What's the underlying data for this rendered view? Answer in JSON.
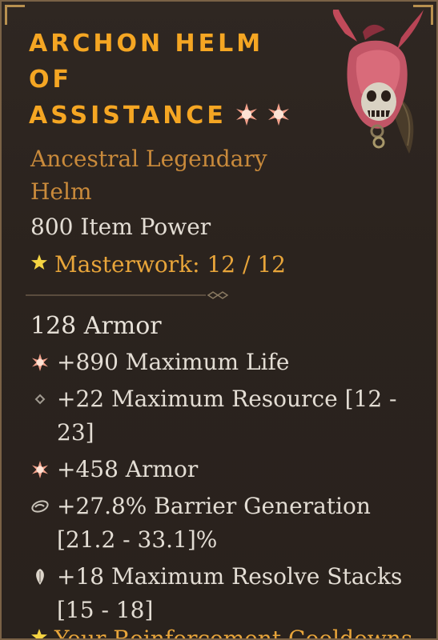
{
  "item": {
    "name_line1": "ARCHON HELM",
    "name_line2": "OF",
    "name_line3": "ASSISTANCE",
    "rarity_line1": "Ancestral Legendary",
    "rarity_line2": "Helm",
    "item_power": "800 Item Power",
    "masterwork": "Masterwork: 12 / 12",
    "base_armor": "128 Armor"
  },
  "affixes": [
    {
      "text": "+890 Maximum Life",
      "icon": "greater-affix-star-icon"
    },
    {
      "text": "+22 Maximum Resource [12 - 23]",
      "icon": "diamond-bullet-icon"
    },
    {
      "text": "+458 Armor",
      "icon": "greater-affix-star-icon"
    },
    {
      "text": "+27.8% Barrier Generation [21.2 - 33.1]%",
      "icon": "tempered-spiral-icon"
    },
    {
      "text": "+18 Maximum Resolve Stacks [15 - 18]",
      "icon": "shield-leaf-icon"
    }
  ],
  "cut_off_text": "Your Reinforcement Cooldowns",
  "colors": {
    "title": "#f5a623",
    "rarity": "#c98a3b",
    "masterwork": "#e8a53a",
    "body_text": "#e3ddd4",
    "greater_affix": "#f3a08a",
    "background": "#2b231e"
  }
}
